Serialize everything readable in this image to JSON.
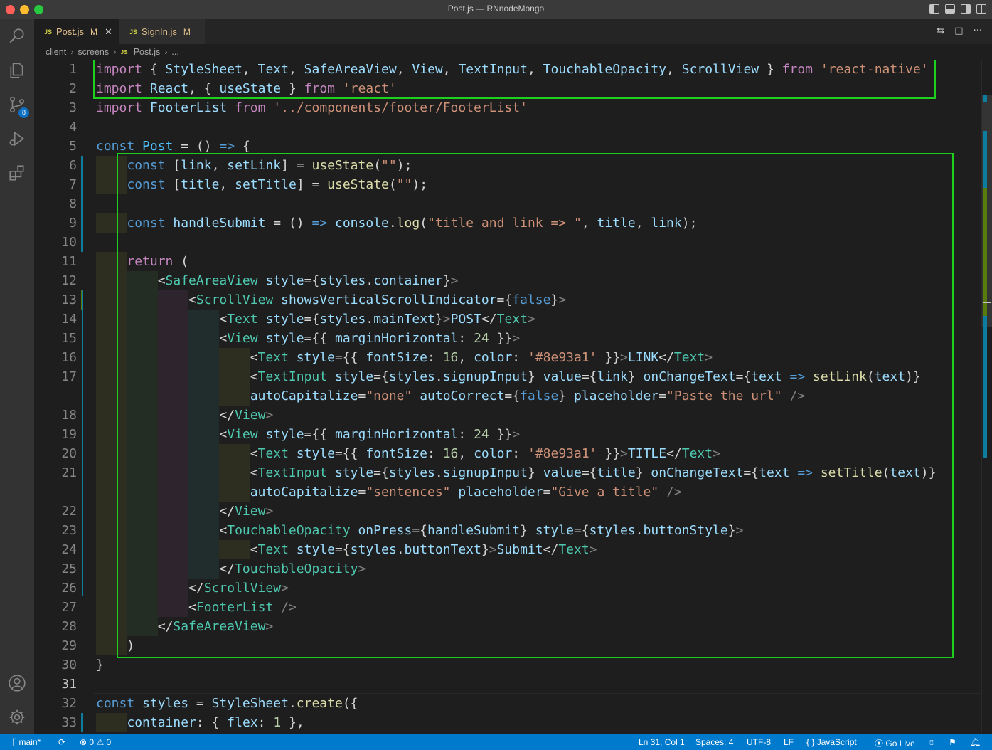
{
  "window": {
    "title": "Post.js — RNnodeMongo"
  },
  "activity_bar": {
    "items": [
      "explorer-icon",
      "search-icon",
      "source-control-icon",
      "run-debug-icon",
      "extensions-icon"
    ],
    "source_control_badge": "8",
    "bottom": [
      "accounts-icon",
      "manage-gear-icon"
    ]
  },
  "tabs": [
    {
      "icon": "JS",
      "label": "Post.js",
      "status": "M",
      "active": true
    },
    {
      "icon": "JS",
      "label": "SignIn.js",
      "status": "M",
      "active": false
    }
  ],
  "breadcrumb": {
    "parts": [
      "client",
      "screens"
    ],
    "file_icon": "JS",
    "file": "Post.js",
    "more": "..."
  },
  "editor": {
    "current_line": "31",
    "lines": [
      {
        "n": "1",
        "text": "import { StyleSheet, Text, SafeAreaView, View, TextInput, TouchableOpacity, ScrollView } from 'react-native'"
      },
      {
        "n": "2",
        "text": "import React, { useState } from 'react'"
      },
      {
        "n": "3",
        "text": "import FooterList from '../components/footer/FooterList'"
      },
      {
        "n": "4",
        "text": ""
      },
      {
        "n": "5",
        "text": "const Post = () => {"
      },
      {
        "n": "6",
        "text": "    const [link, setLink] = useState(\"\");"
      },
      {
        "n": "7",
        "text": "    const [title, setTitle] = useState(\"\");"
      },
      {
        "n": "8",
        "text": ""
      },
      {
        "n": "9",
        "text": "    const handleSubmit = () => console.log(\"title and link => \", title, link);"
      },
      {
        "n": "10",
        "text": ""
      },
      {
        "n": "11",
        "text": "    return ("
      },
      {
        "n": "12",
        "text": "        <SafeAreaView style={styles.container}>"
      },
      {
        "n": "13",
        "text": "            <ScrollView showsVerticalScrollIndicator={false}>"
      },
      {
        "n": "14",
        "text": "                <Text style={styles.mainText}>POST</Text>"
      },
      {
        "n": "15",
        "text": "                <View style={{ marginHorizontal: 24 }}>"
      },
      {
        "n": "16",
        "text": "                    <Text style={{ fontSize: 16, color: '#8e93a1' }}>LINK</Text>"
      },
      {
        "n": "17",
        "text": "                    <TextInput style={styles.signupInput} value={link} onChangeText={text => setLink(text)}"
      },
      {
        "n": "",
        "text": "                    autoCapitalize=\"none\" autoCorrect={false} placeholder=\"Paste the url\" />"
      },
      {
        "n": "18",
        "text": "                </View>"
      },
      {
        "n": "19",
        "text": "                <View style={{ marginHorizontal: 24 }}>"
      },
      {
        "n": "20",
        "text": "                    <Text style={{ fontSize: 16, color: '#8e93a1' }}>TITLE</Text>"
      },
      {
        "n": "21",
        "text": "                    <TextInput style={styles.signupInput} value={title} onChangeText={text => setTitle(text)}"
      },
      {
        "n": "",
        "text": "                    autoCapitalize=\"sentences\" placeholder=\"Give a title\" />"
      },
      {
        "n": "22",
        "text": "                </View>"
      },
      {
        "n": "23",
        "text": "                <TouchableOpacity onPress={handleSubmit} style={styles.buttonStyle}>"
      },
      {
        "n": "24",
        "text": "                    <Text style={styles.buttonText}>Submit</Text>"
      },
      {
        "n": "25",
        "text": "                </TouchableOpacity>"
      },
      {
        "n": "26",
        "text": "            </ScrollView>"
      },
      {
        "n": "27",
        "text": "            <FooterList />"
      },
      {
        "n": "28",
        "text": "        </SafeAreaView>"
      },
      {
        "n": "29",
        "text": "    )"
      },
      {
        "n": "30",
        "text": "}"
      },
      {
        "n": "31",
        "text": ""
      },
      {
        "n": "32",
        "text": "const styles = StyleSheet.create({"
      },
      {
        "n": "33",
        "text": "    container: { flex: 1 },"
      }
    ]
  },
  "status_bar": {
    "branch": "main*",
    "errors": "0",
    "warnings": "0",
    "position": "Ln 31, Col 1",
    "spaces": "Spaces: 4",
    "encoding": "UTF-8",
    "eol": "LF",
    "language": "JavaScript",
    "go_live": "Go Live"
  },
  "colors": {
    "highlight_box": "#1ed01e",
    "status_bar": "#007acc",
    "activity_bar": "#333333",
    "editor_bg": "#1e1e1e"
  }
}
